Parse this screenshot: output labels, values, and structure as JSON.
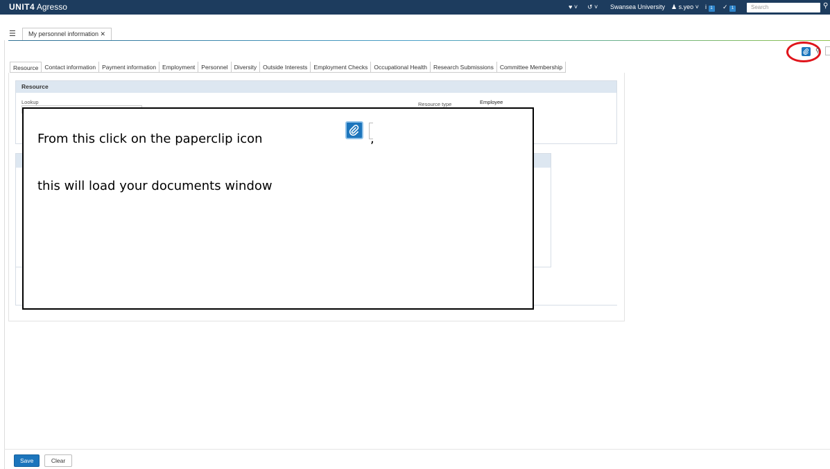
{
  "app": {
    "brand_bold": "UNIT4",
    "brand_light": " Agresso"
  },
  "topbar": {
    "favorites_label": "♥ ˅",
    "history_label": "↺ ˅",
    "org": "Swansea University",
    "user": "s.yeo ˅",
    "info_badge": "1",
    "tasks_badge": "1",
    "search_placeholder": "Search"
  },
  "document_tab": {
    "label": "My personnel information ✕"
  },
  "section_tabs": [
    "Resource",
    "Contact information",
    "Payment information",
    "Employment",
    "Personnel",
    "Diversity",
    "Outside Interests",
    "Employment Checks",
    "Occupational Health",
    "Research Submissions",
    "Committee Membership"
  ],
  "resource_panel": {
    "title": "Resource",
    "lookup_label": "Lookup",
    "resource_type_label": "Resource type",
    "resource_type_value": "Employee"
  },
  "callout": {
    "line1": "From this click on the paperclip icon",
    "comma": ",",
    "line2": "this will load your documents window"
  },
  "footer": {
    "save_label": "Save",
    "clear_label": "Clear"
  },
  "icons": {
    "menu": "list-icon",
    "attachment": "paperclip-icon",
    "search": "search-icon"
  },
  "colors": {
    "topbar": "#1d3c5e",
    "accent": "#1c75bc",
    "highlight_ring": "#e0141b"
  }
}
